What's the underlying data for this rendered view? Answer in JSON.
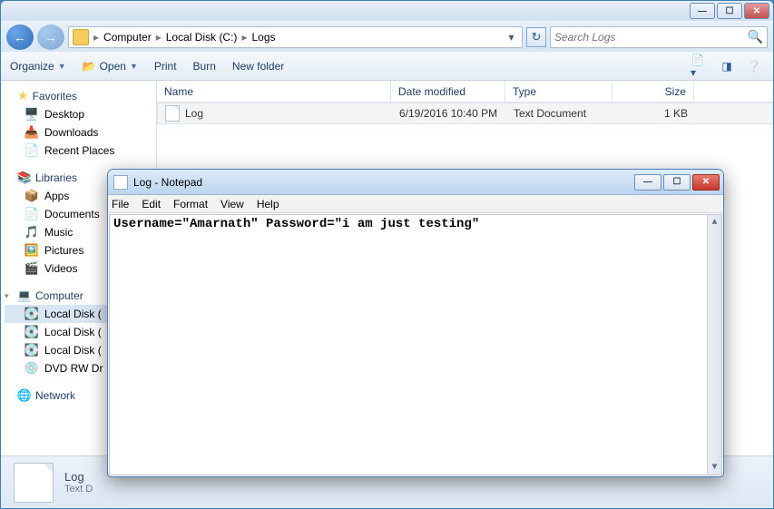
{
  "explorer": {
    "breadcrumb": [
      "Computer",
      "Local Disk (C:)",
      "Logs"
    ],
    "search_placeholder": "Search Logs",
    "toolbar": {
      "organize": "Organize",
      "open": "Open",
      "print": "Print",
      "burn": "Burn",
      "new_folder": "New folder"
    },
    "columns": {
      "name": "Name",
      "date": "Date modified",
      "type": "Type",
      "size": "Size"
    },
    "rows": [
      {
        "name": "Log",
        "date": "6/19/2016 10:40 PM",
        "type": "Text Document",
        "size": "1 KB"
      }
    ],
    "sidebar": {
      "favorites": {
        "label": "Favorites",
        "items": [
          {
            "label": "Desktop",
            "icon": "🖥️"
          },
          {
            "label": "Downloads",
            "icon": "📥"
          },
          {
            "label": "Recent Places",
            "icon": "📄"
          }
        ]
      },
      "libraries": {
        "label": "Libraries",
        "items": [
          {
            "label": "Apps",
            "icon": "📦"
          },
          {
            "label": "Documents",
            "icon": "📄"
          },
          {
            "label": "Music",
            "icon": "🎵"
          },
          {
            "label": "Pictures",
            "icon": "🖼️"
          },
          {
            "label": "Videos",
            "icon": "🎬"
          }
        ]
      },
      "computer": {
        "label": "Computer",
        "items": [
          {
            "label": "Local Disk (",
            "icon": "💽",
            "selected": true
          },
          {
            "label": "Local Disk (",
            "icon": "💽"
          },
          {
            "label": "Local Disk (",
            "icon": "💽"
          },
          {
            "label": "DVD RW Dr",
            "icon": "💿"
          }
        ]
      },
      "network": {
        "label": "Network"
      }
    },
    "status": {
      "name": "Log",
      "type": "Text D"
    }
  },
  "notepad": {
    "title": "Log - Notepad",
    "menu": [
      "File",
      "Edit",
      "Format",
      "View",
      "Help"
    ],
    "content": "Username=\"Amarnath\" Password=\"i am just testing\""
  }
}
